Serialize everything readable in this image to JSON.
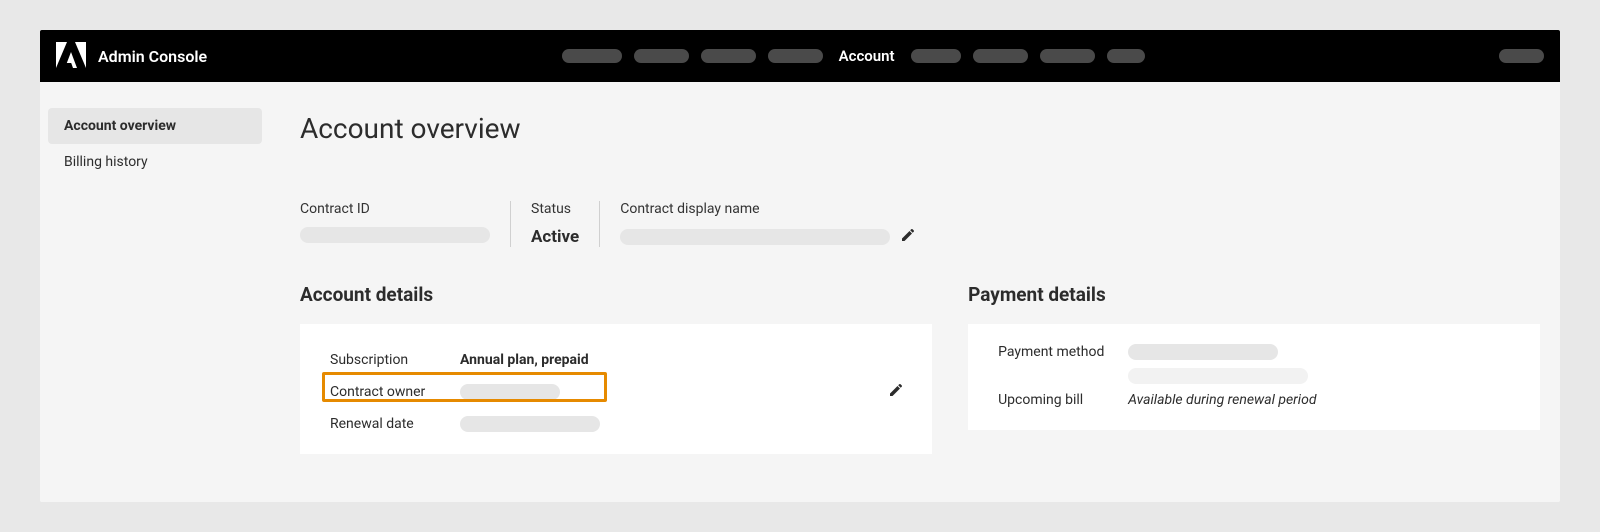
{
  "navbar": {
    "brand_title": "Admin Console",
    "active_tab": "Account"
  },
  "sidebar": {
    "items": [
      {
        "label": "Account overview",
        "active": true
      },
      {
        "label": "Billing history",
        "active": false
      }
    ]
  },
  "page": {
    "title": "Account overview"
  },
  "contract": {
    "id_label": "Contract ID",
    "status_label": "Status",
    "status_value": "Active",
    "display_name_label": "Contract display name"
  },
  "account_details": {
    "title": "Account details",
    "rows": {
      "subscription_label": "Subscription",
      "subscription_value": "Annual plan, prepaid",
      "contract_owner_label": "Contract owner",
      "renewal_date_label": "Renewal date"
    }
  },
  "payment_details": {
    "title": "Payment details",
    "rows": {
      "payment_method_label": "Payment method",
      "upcoming_bill_label": "Upcoming bill",
      "upcoming_bill_value": "Available during renewal period"
    }
  }
}
